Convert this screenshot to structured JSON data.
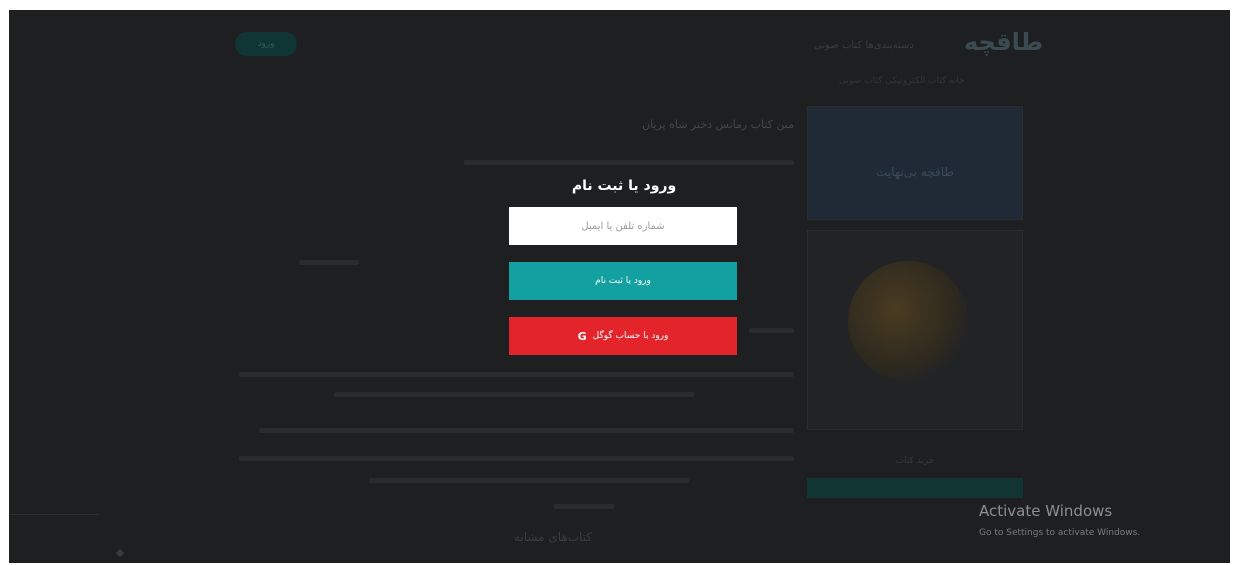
{
  "background_page": {
    "logo_text": "طاقچه",
    "nav_text": "دسته‌بندی‌ها  کتاب صوتی",
    "login_pill": "ورود",
    "subnav_text": "خانه  کتاب الکترونیکی  کتاب صوتی",
    "article_title": "متن کتاب رمانس دختر شاه پریان",
    "sidebar_box_title": "طاقچه بی‌نهایت",
    "sidebar_caption": "خرید کتاب",
    "bottom_text": "کتاب‌های مشابه"
  },
  "modal": {
    "title": "ورود یا ثبت نام",
    "input_placeholder": "شماره تلفن یا ایمیل",
    "login_button": "ورود یا ثبت نام",
    "google_button": "ورود با حساب گوگل",
    "google_icon_glyph": "G"
  },
  "watermark": {
    "title": "Activate Windows",
    "subtitle": "Go to Settings to activate Windows."
  },
  "colors": {
    "overlay": "#1e1f20",
    "login_button": "#12a0a0",
    "google_button": "#e3252b"
  }
}
